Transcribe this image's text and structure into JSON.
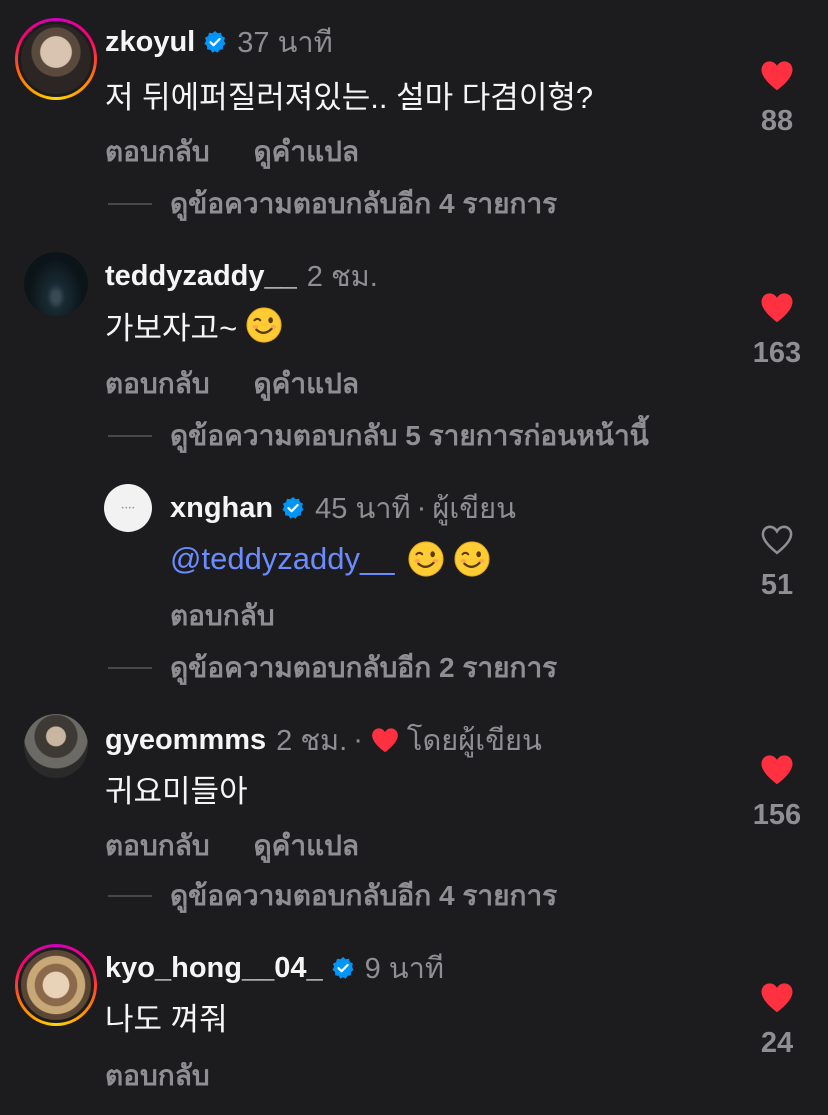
{
  "comments": [
    {
      "username": "zkoyul",
      "verified": true,
      "time": "37 นาที",
      "text": "저 뒤에퍼질러져있는.. 설마 다겸이형?",
      "reply": "ตอบกลับ",
      "translate": "ดูคำแปล",
      "view_replies": "ดูข้อความตอบกลับอีก 4 รายการ",
      "likes": "88",
      "liked": true
    },
    {
      "username": "teddyzaddy__",
      "verified": false,
      "time": "2 ชม.",
      "text": "가보자고~",
      "emoji": "wink-emoji",
      "reply": "ตอบกลับ",
      "translate": "ดูคำแปล",
      "view_replies": "ดูข้อความตอบกลับ 5 รายการก่อนหน้านี้",
      "likes": "163",
      "liked": true
    },
    {
      "username": "xnghan",
      "verified": true,
      "time": "45 นาที",
      "separator": "·",
      "author_label": "ผู้เขียน",
      "mention": "@teddyzaddy__",
      "reply": "ตอบกลับ",
      "view_replies": "ดูข้อความตอบกลับอีก 2 รายการ",
      "likes": "51",
      "liked": false
    },
    {
      "username": "gyeommms",
      "verified": false,
      "time": "2 ชม.",
      "separator": "·",
      "liked_by_author": "โดยผู้เขียน",
      "text": "귀요미들아",
      "reply": "ตอบกลับ",
      "translate": "ดูคำแปล",
      "view_replies": "ดูข้อความตอบกลับอีก 4 รายการ",
      "likes": "156",
      "liked": true
    },
    {
      "username": "kyo_hong__04_",
      "verified": true,
      "time": "9 นาที",
      "text": "나도 껴줘",
      "reply": "ตอบกลับ",
      "likes": "24",
      "liked": true
    }
  ],
  "colors": {
    "background": "#1c1c1e",
    "heart": "#ff3040",
    "verified": "#0095f6",
    "mention": "#6b8cff",
    "secondary": "#8e8e93"
  }
}
